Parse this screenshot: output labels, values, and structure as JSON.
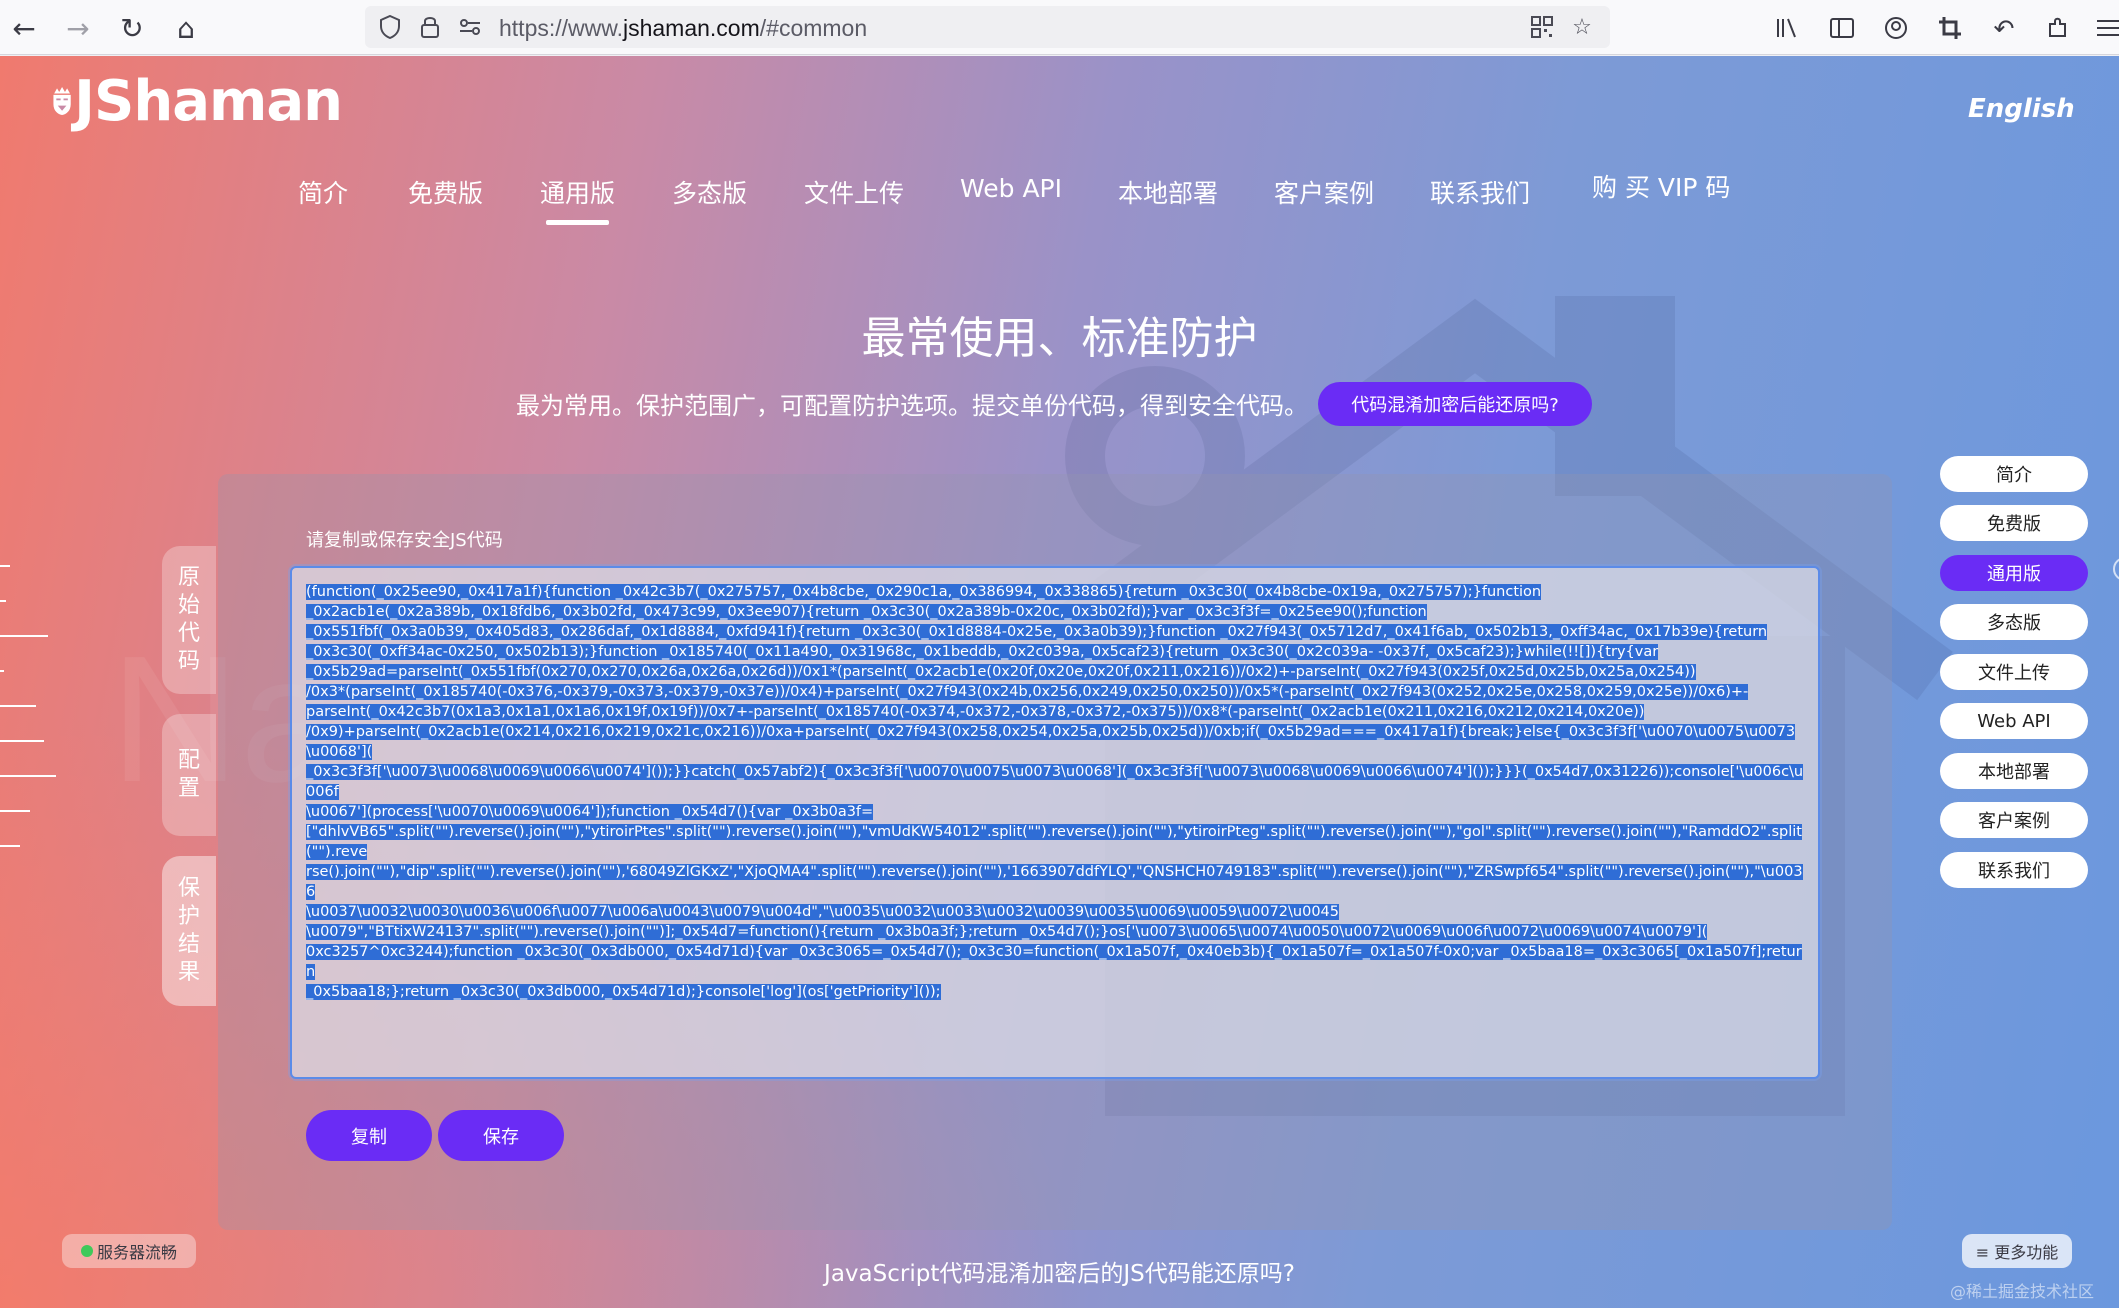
{
  "browser": {
    "url_prefix": "https://www.",
    "url_domain": "jshaman.com",
    "url_suffix": "/#common",
    "icons": [
      "back-icon",
      "forward-icon",
      "reload-icon",
      "home-icon",
      "shield-icon",
      "lock-icon",
      "permissions-icon",
      "qr-code-icon",
      "bookmark-star-icon",
      "library-icon",
      "sidebar-icon",
      "account-icon",
      "screenshot-icon",
      "undo-icon",
      "extensions-icon",
      "menu-icon"
    ]
  },
  "brand": {
    "logo_text": "JShaman"
  },
  "header": {
    "language_link": "English"
  },
  "nav": {
    "items": [
      "简介",
      "免费版",
      "通用版",
      "多态版",
      "文件上传",
      "Web API",
      "本地部署",
      "客户案例",
      "联系我们"
    ],
    "vip": "购 买 VIP 码",
    "active": "通用版"
  },
  "hero": {
    "title": "最常使用、标准防护",
    "subtitle": "最为常用。保护范围广，可配置防护选项。提交单份代码，得到安全代码。",
    "faq_button": "代码混淆加密后能还原吗?"
  },
  "side_tabs": [
    {
      "label": "原始代码"
    },
    {
      "label": "配置"
    },
    {
      "label": "保护结果"
    }
  ],
  "result": {
    "label": "请复制或保存安全JS代码",
    "code_lines": [
      "(function(_0x25ee90,_0x417a1f){function _0x42c3b7(_0x275757,_0x4b8cbe,_0x290c1a,_0x386994,_0x338865){return _0x3c30(_0x4b8cbe-0x19a,_0x275757);}function",
      "_0x2acb1e(_0x2a389b,_0x18fdb6,_0x3b02fd,_0x473c99,_0x3ee907){return _0x3c30(_0x2a389b-0x20c,_0x3b02fd);}var _0x3c3f3f=_0x25ee90();function",
      "_0x551fbf(_0x3a0b39,_0x405d83,_0x286daf,_0x1d8884,_0xfd941f){return _0x3c30(_0x1d8884-0x25e,_0x3a0b39);}function _0x27f943(_0x5712d7,_0x41f6ab,_0x502b13,_0xff34ac,_0x17b39e){return",
      "_0x3c30(_0xff34ac-0x250,_0x502b13);}function _0x185740(_0x11a490,_0x31968c,_0x1beddb,_0x2c039a,_0x5caf23){return _0x3c30(_0x2c039a- -0x37f,_0x5caf23);}while(!![]){try{var",
      "_0x5b29ad=parseInt(_0x551fbf(0x270,0x270,0x26a,0x26a,0x26d))/0x1*(parseInt(_0x2acb1e(0x20f,0x20e,0x20f,0x211,0x216))/0x2)+-parseInt(_0x27f943(0x25f,0x25d,0x25b,0x25a,0x254))",
      "/0x3*(parseInt(_0x185740(-0x376,-0x379,-0x373,-0x379,-0x37e))/0x4)+parseInt(_0x27f943(0x24b,0x256,0x249,0x250,0x250))/0x5*(-parseInt(_0x27f943(0x252,0x25e,0x258,0x259,0x25e))/0x6)+-",
      "parseInt(_0x42c3b7(0x1a3,0x1a1,0x1a6,0x19f,0x19f))/0x7+-parseInt(_0x185740(-0x374,-0x372,-0x378,-0x372,-0x375))/0x8*(-parseInt(_0x2acb1e(0x211,0x216,0x212,0x214,0x20e))",
      "/0x9)+parseInt(_0x2acb1e(0x214,0x216,0x219,0x21c,0x216))/0xa+parseInt(_0x27f943(0x258,0x254,0x25a,0x25b,0x25d))/0xb;if(_0x5b29ad===_0x417a1f){break;}else{_0x3c3f3f['\\u0070\\u0075\\u0073\\u0068'](",
      "_0x3c3f3f['\\u0073\\u0068\\u0069\\u0066\\u0074']());}}catch(_0x57abf2){_0x3c3f3f['\\u0070\\u0075\\u0073\\u0068'](_0x3c3f3f['\\u0073\\u0068\\u0069\\u0066\\u0074']());}}}(_0x54d7,0x31226));console['\\u006c\\u006f",
      "\\u0067'](process['\\u0070\\u0069\\u0064']);function _0x54d7(){var _0x3b0a3f=",
      "[\"dhlvVB65\".split(\"\").reverse().join(\"\"),\"ytiroirPtes\".split(\"\").reverse().join(\"\"),\"vmUdKW54012\".split(\"\").reverse().join(\"\"),\"ytiroirPteg\".split(\"\").reverse().join(\"\"),\"gol\".split(\"\").reverse().join(\"\"),\"RamddO2\".split(\"\").reve",
      "rse().join(\"\"),\"dip\".split(\"\").reverse().join(\"\"),'68049ZlGKxZ',\"XjoQMA4\".split(\"\").reverse().join(\"\"),'1663907ddfYLQ',\"QNSHCH0749183\".split(\"\").reverse().join(\"\"),\"ZRSwpf654\".split(\"\").reverse().join(\"\"),\"\\u0036",
      "\\u0037\\u0032\\u0030\\u0036\\u006f\\u0077\\u006a\\u0043\\u0079\\u004d\",\"\\u0035\\u0032\\u0033\\u0032\\u0039\\u0035\\u0069\\u0059\\u0072\\u0045",
      "\\u0079\",\"BTtixW24137\".split(\"\").reverse().join(\"\")];_0x54d7=function(){return _0x3b0a3f;};return _0x54d7();}os['\\u0073\\u0065\\u0074\\u0050\\u0072\\u0069\\u006f\\u0072\\u0069\\u0074\\u0079'](",
      "0xc3257^0xc3244);function _0x3c30(_0x3db000,_0x54d71d){var _0x3c3065=_0x54d7();_0x3c30=function(_0x1a507f,_0x40eb3b){_0x1a507f=_0x1a507f-0x0;var _0x5baa18=_0x3c3065[_0x1a507f];return",
      "_0x5baa18;};return _0x3c30(_0x3db000,_0x54d71d);}console['log'](os['getPriority']());"
    ],
    "copy_button": "复制",
    "save_button": "保存"
  },
  "right_menu": {
    "items": [
      "简介",
      "免费版",
      "通用版",
      "多态版",
      "文件上传",
      "Web API",
      "本地部署",
      "客户案例",
      "联系我们"
    ],
    "active": "通用版"
  },
  "footer": {
    "server_status": "服务器流畅",
    "more_button": "≡ 更多功能",
    "faq_link": "JavaScript代码混淆加密后的JS代码能还原吗?",
    "corner_mark": "@稀土掘金技术社区"
  },
  "colors": {
    "accent": "#6a2cf5",
    "selection": "#2f6dd6",
    "status_ok": "#3fc95a"
  }
}
